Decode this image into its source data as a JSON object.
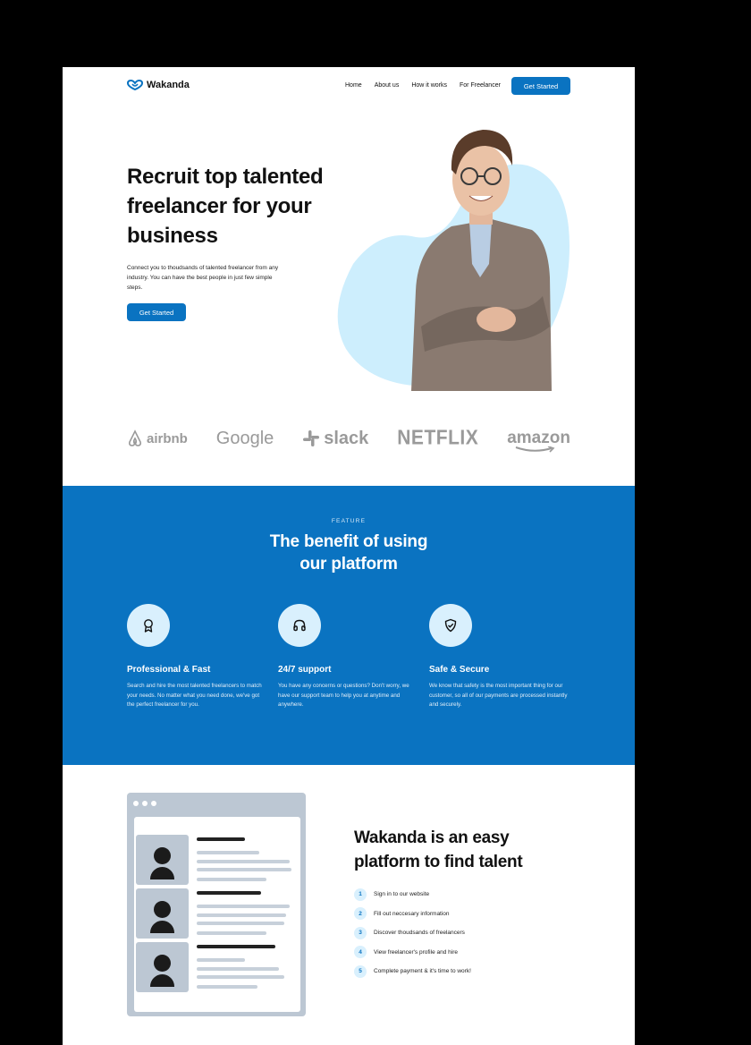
{
  "brand": {
    "name": "Wakanda",
    "accent": "#0a73c1",
    "light_accent": "#d9f0fd"
  },
  "nav": {
    "links": [
      "Home",
      "About us",
      "How it works",
      "For Freelancer"
    ],
    "cta": "Get Started"
  },
  "hero": {
    "title": "Recruit top talented freelancer for your business",
    "subtitle": "Connect you to thoudsands of talented freelancer from any industry. You can have the best people in just few simple steps.",
    "cta": "Get Started"
  },
  "partners": [
    "airbnb",
    "Google",
    "slack",
    "NETFLIX",
    "amazon"
  ],
  "feature": {
    "eyebrow": "FEATURE",
    "title_line1": "The benefit of using",
    "title_line2": "our platform",
    "cards": [
      {
        "icon": "award-icon",
        "title": "Professional & Fast",
        "text": "Search and hire the most talented freelancers to match your needs. No matter what you need done, we've got the perfect freelancer for you."
      },
      {
        "icon": "headphones-icon",
        "title": "24/7 support",
        "text": "You have any concerns or questions? Don't worry, we have our support team to help you at anytime and anywhere."
      },
      {
        "icon": "shield-check-icon",
        "title": "Safe & Secure",
        "text": "We know that safety is the most important thing for our customer, so all of our payments are processed instantly and securely."
      }
    ]
  },
  "how": {
    "title": "Wakanda is an easy platform to find talent",
    "steps": [
      {
        "num": "1",
        "text": "Sign in to our website"
      },
      {
        "num": "2",
        "text": "Fill out neccesary information"
      },
      {
        "num": "3",
        "text": "Discover thoudsands of freelancers"
      },
      {
        "num": "4",
        "text": "View freelancer's profile and hire"
      },
      {
        "num": "5",
        "text": "Complete payment & it's time to work!"
      }
    ]
  }
}
